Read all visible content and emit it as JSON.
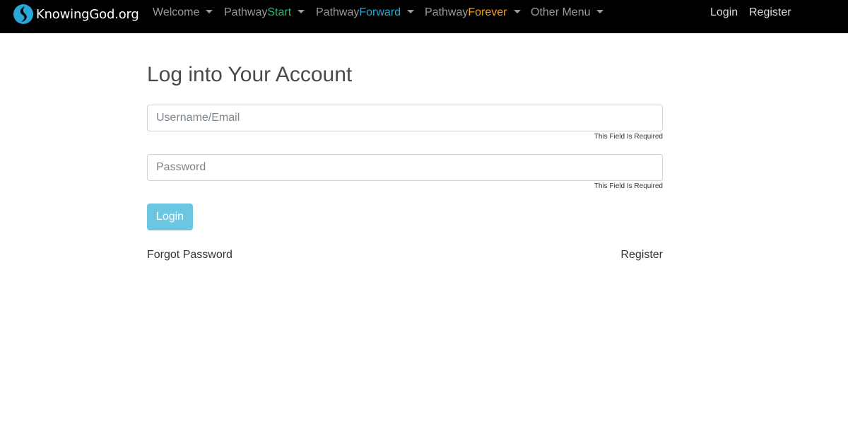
{
  "navbar": {
    "brand": {
      "text": "KnowingGod.org",
      "logo_icon": "flame-swirl-logo",
      "logo_color": "#29a8d8"
    },
    "menu": [
      {
        "prefix": "",
        "suffix": "Welcome",
        "suffix_color": "#9a9a9a",
        "has_dropdown": true
      },
      {
        "prefix": "Pathway",
        "suffix": "Start",
        "suffix_color": "#2bb673",
        "has_dropdown": true
      },
      {
        "prefix": "Pathway",
        "suffix": "Forward",
        "suffix_color": "#29a8d8",
        "has_dropdown": true
      },
      {
        "prefix": "Pathway",
        "suffix": "Forever",
        "suffix_color": "#f7a11a",
        "has_dropdown": true
      },
      {
        "prefix": "",
        "suffix": "Other Menu",
        "suffix_color": "#9a9a9a",
        "has_dropdown": true
      }
    ],
    "login_label": "Login",
    "register_label": "Register",
    "dropdown_icon": "caret-down-icon"
  },
  "form": {
    "title": "Log into Your Account",
    "username": {
      "value": "",
      "placeholder": "Username/Email",
      "help": "This Field Is Required"
    },
    "password": {
      "value": "",
      "placeholder": "Password",
      "help": "This Field Is Required"
    },
    "submit_label": "Login",
    "submit_color": "#5bc0de",
    "forgot_label": "Forgot Password",
    "register_label": "Register"
  }
}
